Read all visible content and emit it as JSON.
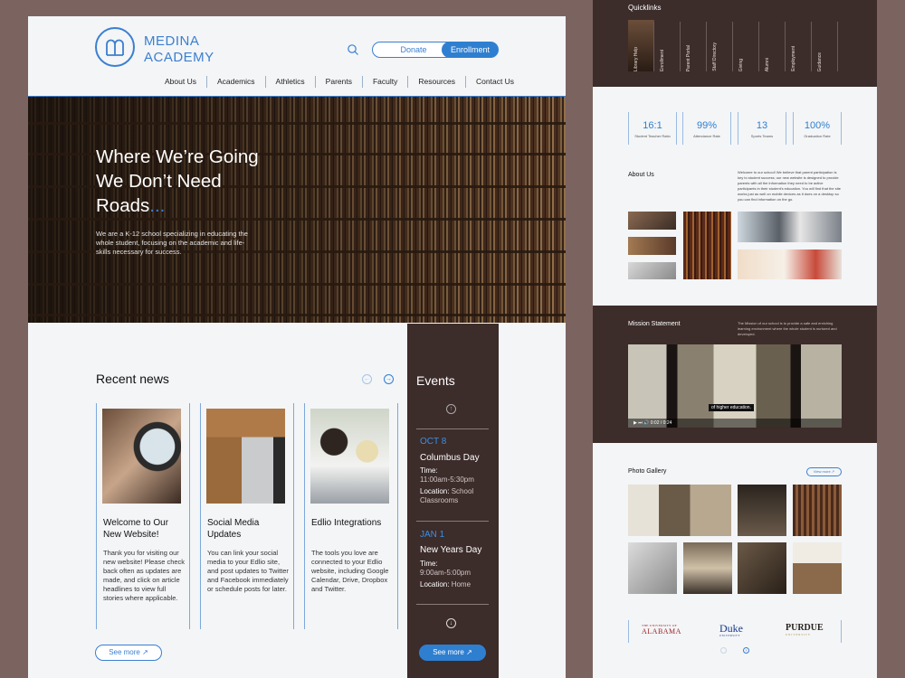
{
  "brand": {
    "line1": "MEDINA",
    "line2": "ACADEMY"
  },
  "header": {
    "donate_label": "Donate",
    "enroll_label": "Enrollment",
    "nav": [
      "About Us",
      "Academics",
      "Athletics",
      "Parents",
      "Faculty",
      "Resources",
      "Contact Us"
    ]
  },
  "hero": {
    "title_line1": "Where We’re Going",
    "title_line2": "We Don’t Need",
    "title_line3": "Roads",
    "title_dots": "...",
    "subtitle": "We are a K-12 school specializing in educating the whole student, focusing on the academic and life-skills necessary for success."
  },
  "news": {
    "heading": "Recent news",
    "prev_icon": "←",
    "next_icon": "→",
    "see_more": "See more ↗",
    "cards": [
      {
        "title": "Welcome to Our New Website!",
        "body": "Thank you for visiting our new website! Please check back often as updates are made, and click on article headlines to view full stories where applicable."
      },
      {
        "title": "Social Media Updates",
        "body": "You can link your social media to your Edlio site, and post updates to Twitter and Facebook immediately or schedule posts for later."
      },
      {
        "title": "Edlio Integrations",
        "body": "The tools you love are connected to your Edlio website, including Google Calendar, Drive, Dropbox and Twitter."
      }
    ]
  },
  "events": {
    "heading": "Events",
    "up_icon": "↑",
    "down_icon": "↓",
    "see_more": "See more ↗",
    "items": [
      {
        "date": "OCT 8",
        "title": "Columbus Day",
        "time_label": "Time:",
        "time": "11:00am-5:30pm",
        "location_label": "Location:",
        "location": "School Classrooms"
      },
      {
        "date": "JAN 1",
        "title": "New Years Day",
        "time_label": "Time:",
        "time": "9:00am-5:00pm",
        "location_label": "Location:",
        "location": "Home"
      }
    ]
  },
  "quicklinks": {
    "title": "Quicklinks",
    "items": [
      "Library Help",
      "Enrollment",
      "Parent Portal",
      "Staff Directory",
      "Giving",
      "Alumni",
      "Employment",
      "Guidance"
    ]
  },
  "stats": [
    {
      "value": "16:1",
      "label": "Student Teacher Ratio"
    },
    {
      "value": "99%",
      "label": "Attendance Rate"
    },
    {
      "value": "13",
      "label": "Sports Teams"
    },
    {
      "value": "100%",
      "label": "Graduation Rate"
    }
  ],
  "about": {
    "title": "About Us",
    "text": "Welcome to our school! We believe that parent participation is key to student success; our new website is designed to provide parents with all the information they need to be active participants in their student's education. You will find that the site works just as well on mobile devices as it does on a desktop so you can find information on the go."
  },
  "mission": {
    "title": "Mission Statement",
    "text": "The Mission of our school is to provide a safe and enriching learning environment where the whole student is nurtured and developed.",
    "caption": "of higher education.",
    "timecode": "0:02 / 0:24"
  },
  "gallery": {
    "title": "Photo Gallery",
    "view_more": "View more ↗"
  },
  "universities": {
    "alabama_small": "THE UNIVERSITY OF",
    "alabama": "ALABAMA",
    "duke": "Duke",
    "duke_small": "UNIVERSITY",
    "purdue": "PURDUE",
    "purdue_small": "UNIVERSITY"
  },
  "colors": {
    "accent": "#2f7fd1",
    "dark": "#3c2c2a",
    "background": "#7b6460",
    "panel": "#f3f5f7"
  }
}
